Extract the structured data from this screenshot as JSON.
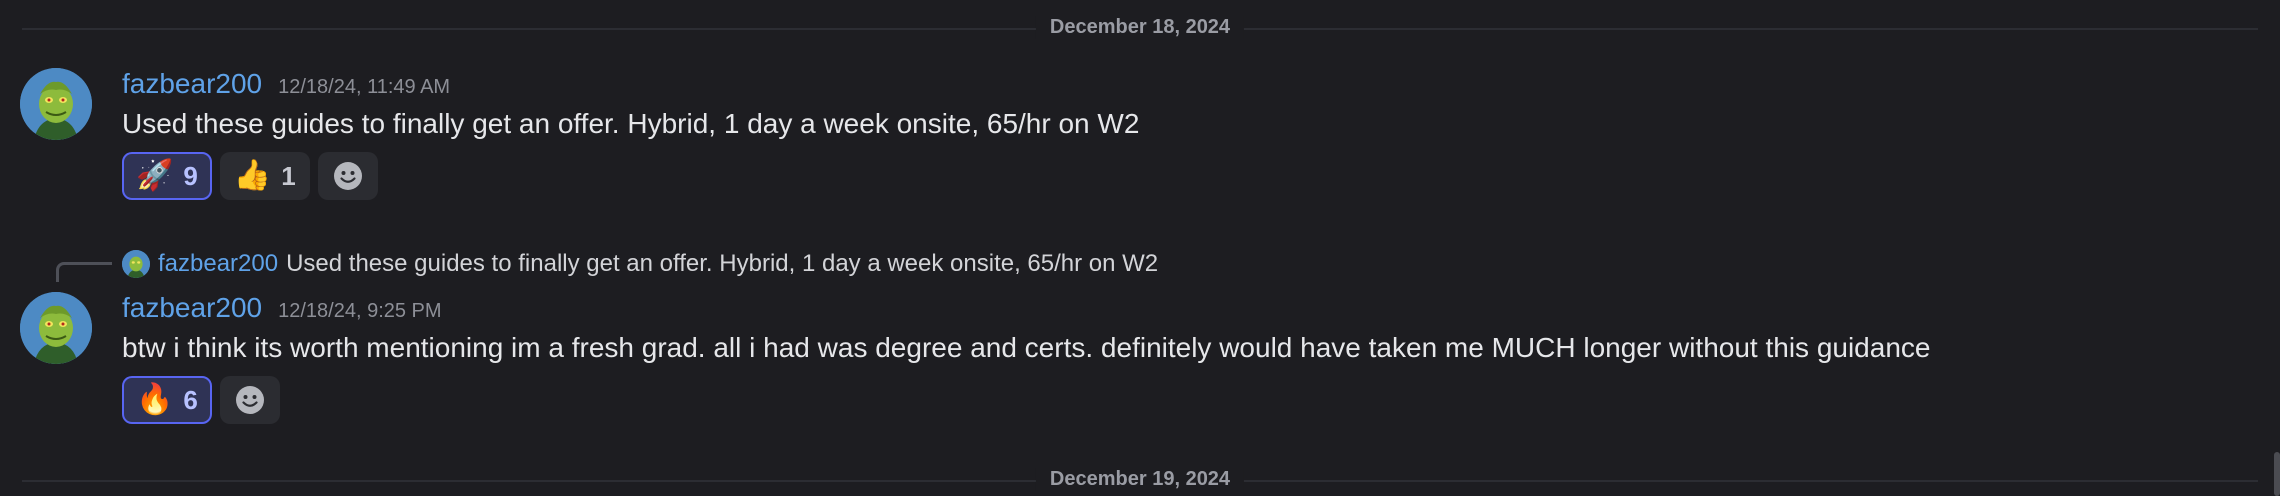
{
  "dividers": [
    {
      "label": "December 18, 2024"
    },
    {
      "label": "December 19, 2024"
    }
  ],
  "messages": [
    {
      "author": "fazbear200",
      "timestamp": "12/18/24, 11:49 AM",
      "content": "Used these guides to finally get an offer. Hybrid, 1 day a week onsite, 65/hr on W2",
      "reactions": [
        {
          "emoji": "🚀",
          "count": "9",
          "icon": "rocket-emoji",
          "reacted": true
        },
        {
          "emoji": "👍",
          "count": "1",
          "icon": "thumbs-up-emoji",
          "reacted": false
        }
      ]
    },
    {
      "author": "fazbear200",
      "timestamp": "12/18/24, 9:25 PM",
      "reply": {
        "author": "fazbear200",
        "text": "Used these guides to finally get an offer. Hybrid, 1 day a week onsite, 65/hr on W2"
      },
      "content": "btw i think its worth mentioning im a fresh grad. all i had was degree and certs. definitely would have taken me MUCH longer without this guidance",
      "reactions": [
        {
          "emoji": "🔥",
          "count": "6",
          "icon": "fire-emoji",
          "reacted": true
        }
      ]
    }
  ],
  "colors": {
    "background": "#1d1d21",
    "username": "#5fa2e8",
    "reacted_border": "#5865f2"
  }
}
